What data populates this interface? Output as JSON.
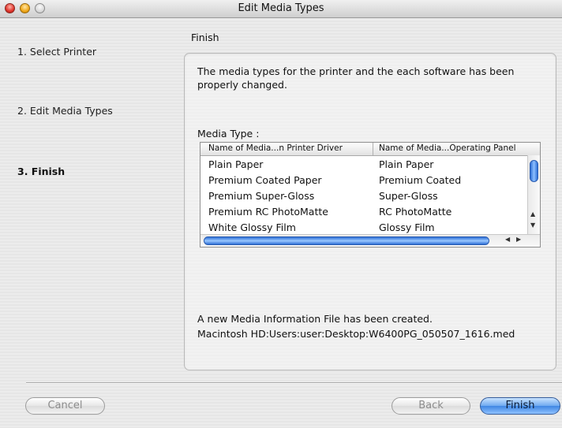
{
  "window": {
    "title": "Edit Media Types"
  },
  "steps": [
    {
      "label": "1. Select Printer"
    },
    {
      "label": "2. Edit Media Types"
    },
    {
      "label": "3. Finish"
    }
  ],
  "section": {
    "title": "Finish"
  },
  "message": {
    "line1": "The media types for the printer and the each software has been",
    "line2": "properly changed."
  },
  "media_type": {
    "label": "Media Type :",
    "columns": [
      "Name of Media...n Printer Driver",
      "Name of Media...Operating Panel"
    ],
    "rows": [
      {
        "driver": "Plain Paper",
        "panel": "Plain Paper"
      },
      {
        "driver": "Premium Coated Paper",
        "panel": "Premium Coated"
      },
      {
        "driver": "Premium Super-Gloss",
        "panel": "Super-Gloss"
      },
      {
        "driver": "Premium RC PhotoMatte",
        "panel": "RC PhotoMatte"
      },
      {
        "driver": "White Glossy Film",
        "panel": "Glossy Film"
      }
    ]
  },
  "info": {
    "line1": "A new Media Information File has been created.",
    "line2": "Macintosh HD:Users:user:Desktop:W6400PG_050507_1616.med"
  },
  "buttons": {
    "cancel": "Cancel",
    "back": "Back",
    "finish": "Finish"
  },
  "icons": {
    "close": "close-icon",
    "minimize": "minimize-icon",
    "zoom": "zoom-icon",
    "scroll_up": "arrow-up-icon",
    "scroll_down": "arrow-down-icon",
    "scroll_left": "arrow-left-icon",
    "scroll_right": "arrow-right-icon"
  },
  "colors": {
    "accent": "#3f86e3",
    "close": "#e0332a",
    "minimize": "#f0a718"
  }
}
